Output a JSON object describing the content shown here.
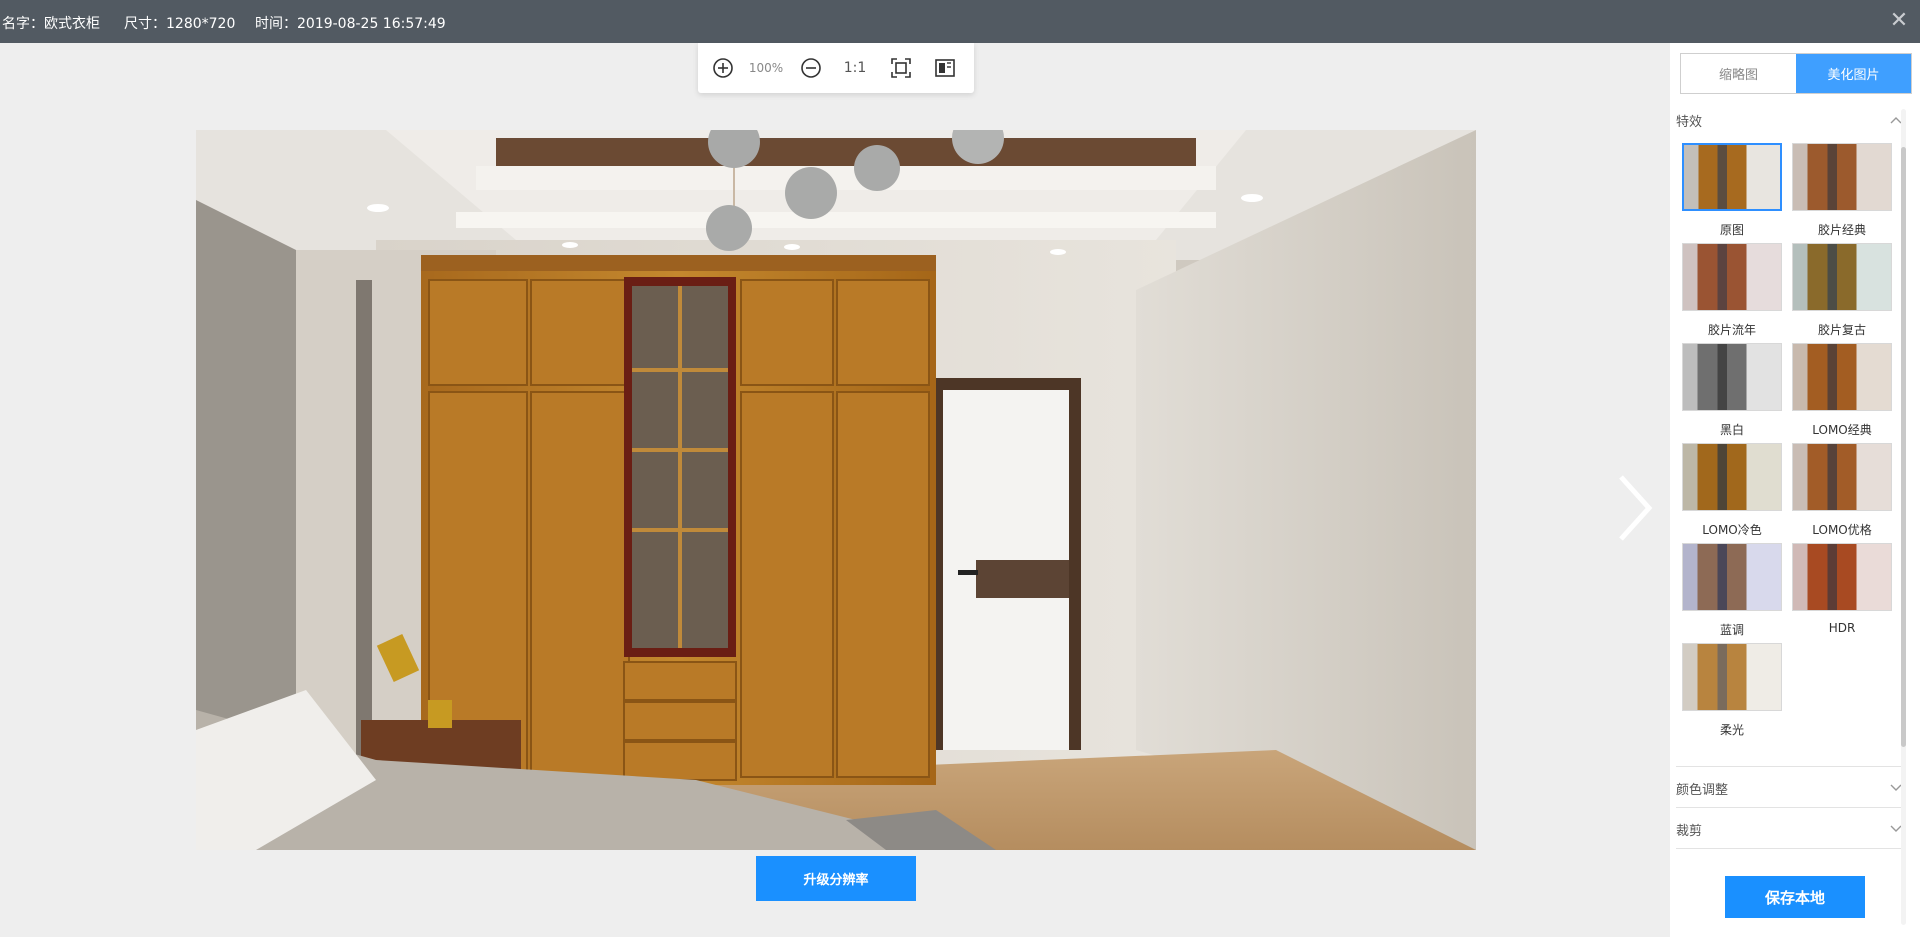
{
  "header": {
    "name_label": "名字：欧式衣柜",
    "size_label": "尺寸：1280*720",
    "time_label": "时间：2019-08-25 16:57:49"
  },
  "toolbar": {
    "zoom_level": "100%",
    "ratio_label": "1:1"
  },
  "actions": {
    "upgrade_label": "升级分辨率",
    "save_label": "保存本地"
  },
  "panel": {
    "tabs": [
      {
        "label": "缩略图",
        "active": false
      },
      {
        "label": "美化图片",
        "active": true
      }
    ],
    "sections": {
      "effects_title": "特效",
      "color_title": "颜色调整",
      "crop_title": "裁剪"
    },
    "effects": [
      {
        "label": "原图",
        "selected": true
      },
      {
        "label": "胶片经典",
        "selected": false
      },
      {
        "label": "胶片流年",
        "selected": false
      },
      {
        "label": "胶片复古",
        "selected": false
      },
      {
        "label": "黑白",
        "selected": false
      },
      {
        "label": "LOMO经典",
        "selected": false
      },
      {
        "label": "LOMO冷色",
        "selected": false
      },
      {
        "label": "LOMO优格",
        "selected": false
      },
      {
        "label": "蓝调",
        "selected": false
      },
      {
        "label": "HDR",
        "selected": false
      },
      {
        "label": "柔光",
        "selected": false
      }
    ]
  },
  "colors": {
    "accent": "#1a90ff",
    "topbar": "#525a62"
  },
  "icons": {
    "zoom_in": "zoom-in-icon",
    "zoom_out": "zoom-out-icon",
    "fit": "fit-screen-icon",
    "compare": "compare-icon",
    "close": "close-icon",
    "next": "chevron-right-icon"
  }
}
